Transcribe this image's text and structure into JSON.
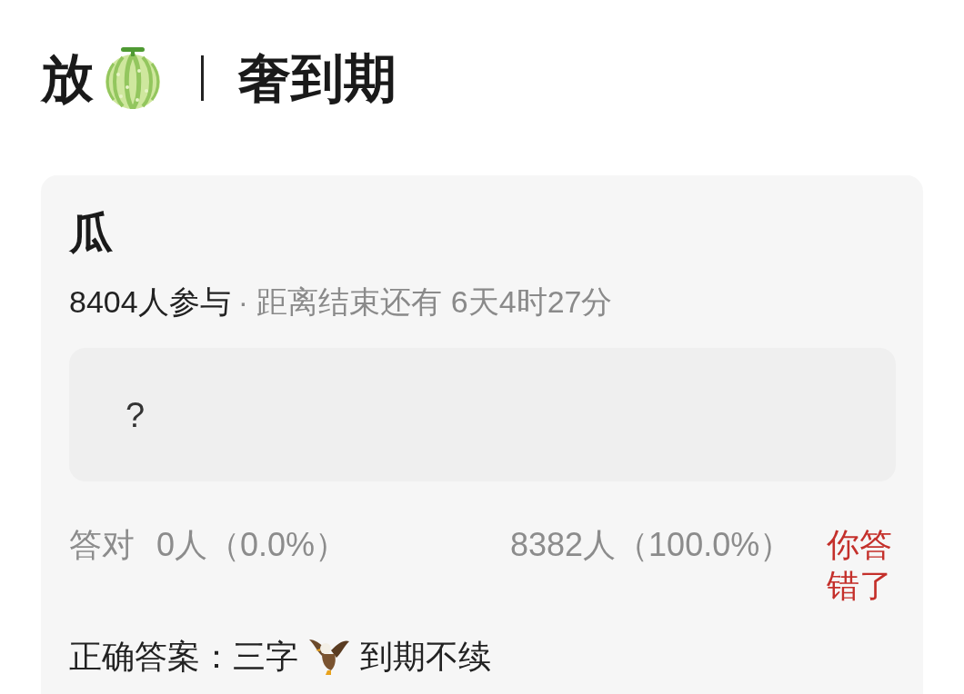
{
  "header": {
    "lead": "放",
    "topic": "奢到期"
  },
  "quiz": {
    "title": "瓜",
    "participants": "8404人参与",
    "time_left": "· 距离结束还有 6天4时27分",
    "question": "?",
    "results": [
      {
        "label": "答对",
        "count": "0人（0.0%）"
      },
      {
        "count": "8382人（100.0%）"
      }
    ],
    "verdict": {
      "text": "你答错了",
      "correct": false
    },
    "correct_answer": {
      "label": "正确答案：",
      "hint": "三字",
      "answer": "到期不续"
    }
  }
}
